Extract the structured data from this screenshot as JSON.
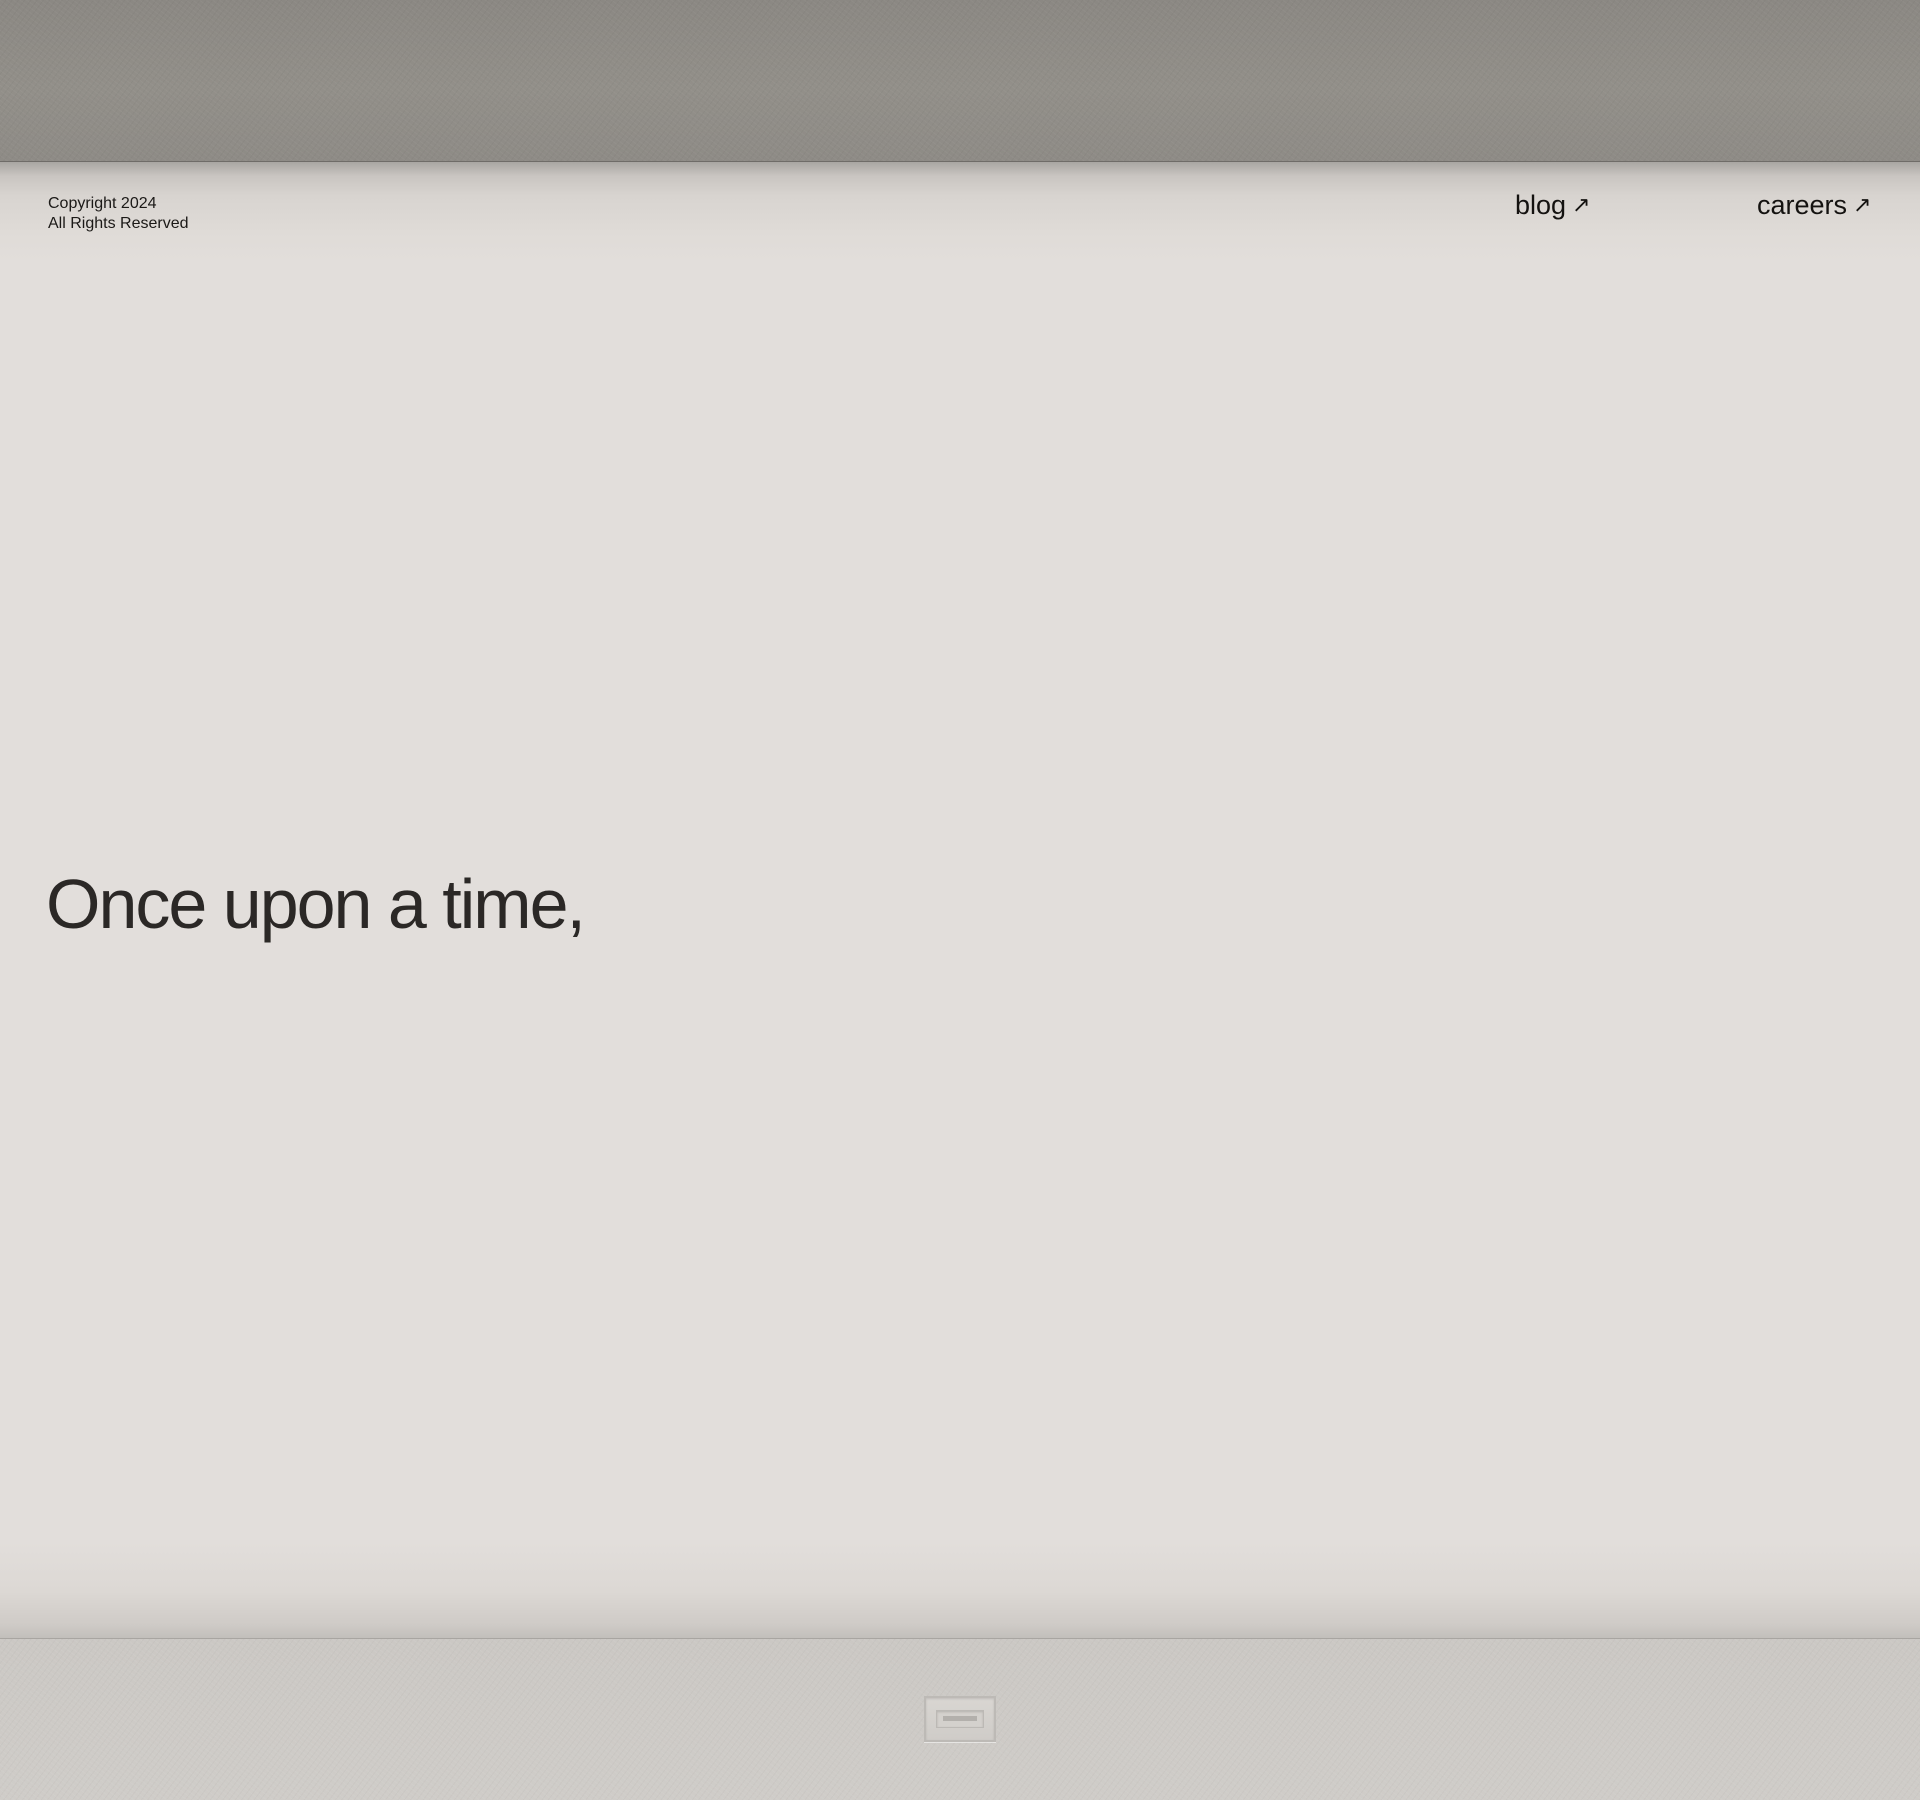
{
  "footer_info": {
    "copyright_line": "Copyright 2024",
    "rights_line": "All Rights Reserved"
  },
  "nav": {
    "items": [
      {
        "label": "blog",
        "icon": "arrow-up-right-icon",
        "glyph": "↗"
      },
      {
        "label": "careers",
        "icon": "arrow-up-right-icon",
        "glyph": "↗"
      }
    ]
  },
  "hero": {
    "headline": "Once upon a time,"
  },
  "colors": {
    "background": "#e2dedb",
    "top_slab": "#8e8b86",
    "bottom_slab": "#cdcac6",
    "text": "#2b2826"
  }
}
